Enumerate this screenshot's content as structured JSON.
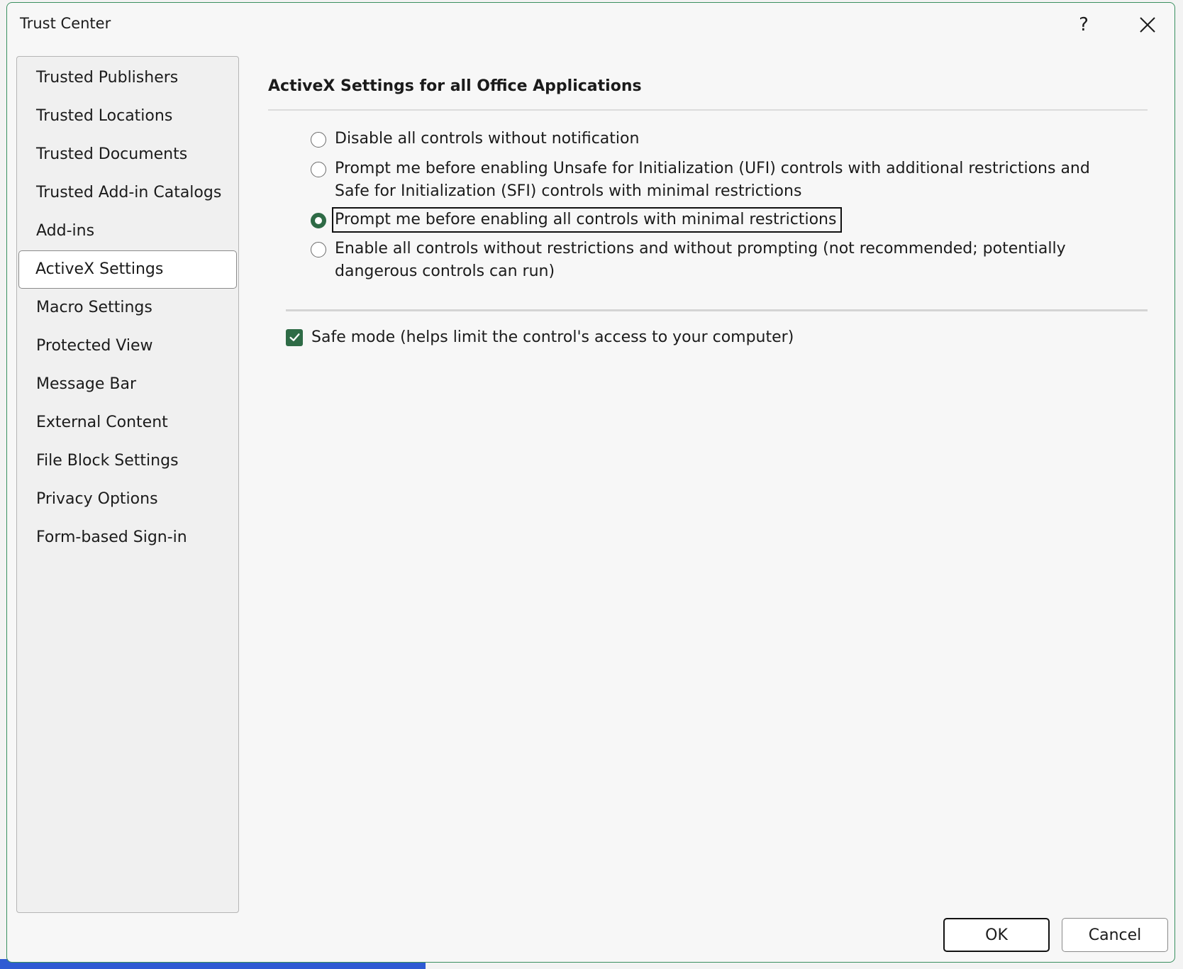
{
  "dialog": {
    "title": "Trust Center",
    "help_label": "?",
    "close_icon": "close-icon"
  },
  "sidebar": {
    "items": [
      {
        "label": "Trusted Publishers"
      },
      {
        "label": "Trusted Locations"
      },
      {
        "label": "Trusted Documents"
      },
      {
        "label": "Trusted Add-in Catalogs"
      },
      {
        "label": "Add-ins"
      },
      {
        "label": "ActiveX Settings"
      },
      {
        "label": "Macro Settings"
      },
      {
        "label": "Protected View"
      },
      {
        "label": "Message Bar"
      },
      {
        "label": "External Content"
      },
      {
        "label": "File Block Settings"
      },
      {
        "label": "Privacy Options"
      },
      {
        "label": "Form-based Sign-in"
      }
    ],
    "selected": "ActiveX Settings"
  },
  "main": {
    "section_title": "ActiveX Settings for all Office Applications",
    "options": [
      {
        "label": "Disable all controls without notification",
        "checked": false
      },
      {
        "label": "Prompt me before enabling Unsafe for Initialization (UFI) controls with additional restrictions and Safe for Initialization (SFI) controls with minimal restrictions",
        "checked": false
      },
      {
        "label": "Prompt me before enabling all controls with minimal restrictions",
        "checked": true
      },
      {
        "label": "Enable all controls without restrictions and without prompting (not recommended; potentially dangerous controls can run)",
        "checked": false
      }
    ],
    "safe_mode": {
      "label": "Safe mode (helps limit the control's access to your computer)",
      "checked": true
    }
  },
  "buttons": {
    "ok": "OK",
    "cancel": "Cancel"
  },
  "colors": {
    "accent": "#2e6b46",
    "dialog_border": "#3a8f5f"
  }
}
